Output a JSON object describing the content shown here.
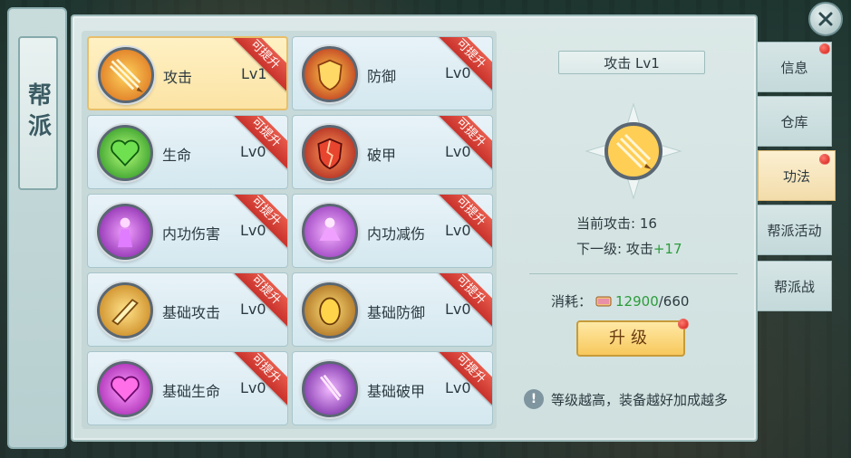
{
  "guild_title": "帮派",
  "skills": [
    {
      "name": "攻击",
      "level": "Lv1",
      "badge": "可提升",
      "icon": "spear-icon"
    },
    {
      "name": "防御",
      "level": "Lv0",
      "badge": "可提升",
      "icon": "shield-icon"
    },
    {
      "name": "生命",
      "level": "Lv0",
      "badge": "可提升",
      "icon": "heart-icon"
    },
    {
      "name": "破甲",
      "level": "Lv0",
      "badge": "可提升",
      "icon": "broken-shield-icon"
    },
    {
      "name": "内功伤害",
      "level": "Lv0",
      "badge": "可提升",
      "icon": "inner-power-attack-icon"
    },
    {
      "name": "内功减伤",
      "level": "Lv0",
      "badge": "可提升",
      "icon": "inner-power-defense-icon"
    },
    {
      "name": "基础攻击",
      "level": "Lv0",
      "badge": "可提升",
      "icon": "base-attack-icon"
    },
    {
      "name": "基础防御",
      "level": "Lv0",
      "badge": "可提升",
      "icon": "base-defense-icon"
    },
    {
      "name": "基础生命",
      "level": "Lv0",
      "badge": "可提升",
      "icon": "base-life-icon"
    },
    {
      "name": "基础破甲",
      "level": "Lv0",
      "badge": "可提升",
      "icon": "base-armor-break-icon"
    }
  ],
  "detail": {
    "title": "攻击 Lv1",
    "current_label": "当前攻击:",
    "current_value": "16",
    "next_label": "下一级: 攻击",
    "next_bonus": "+17",
    "cost_label": "消耗：",
    "cost_have": "12900",
    "cost_need": "/660",
    "upgrade_button": "升级",
    "tip": "等级越高，装备越好加成越多"
  },
  "tabs": [
    {
      "label": "信息",
      "active": false
    },
    {
      "label": "仓库",
      "active": false
    },
    {
      "label": "功法",
      "active": true
    },
    {
      "label": "帮派活动",
      "active": false
    },
    {
      "label": "帮派战",
      "active": false
    }
  ],
  "colors": {
    "accent_gold": "#f7c85c",
    "ribbon_red": "#d6382f",
    "bonus_green": "#2c9c3c"
  }
}
